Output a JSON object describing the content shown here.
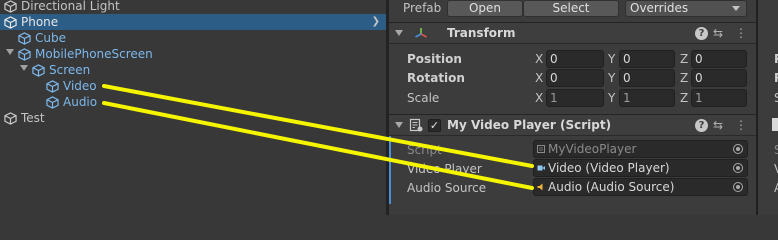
{
  "hierarchy": {
    "items": [
      {
        "label": "Directional Light"
      },
      {
        "label": "Phone"
      },
      {
        "label": "Cube"
      },
      {
        "label": "MobilePhoneScreen"
      },
      {
        "label": "Screen"
      },
      {
        "label": "Video"
      },
      {
        "label": "Audio"
      },
      {
        "label": "Test"
      }
    ]
  },
  "inspector": {
    "prefab": {
      "label": "Prefab",
      "open": "Open",
      "select": "Select",
      "overrides": "Overrides"
    },
    "transform": {
      "title": "Transform",
      "rows": [
        {
          "label": "Position",
          "x": "0",
          "y": "0",
          "z": "0"
        },
        {
          "label": "Rotation",
          "x": "0",
          "y": "0",
          "z": "0"
        },
        {
          "label": "Scale",
          "x": "1",
          "y": "1",
          "z": "1"
        }
      ],
      "axes": {
        "x": "X",
        "y": "Y",
        "z": "Z"
      }
    },
    "script_component": {
      "title": "My Video Player (Script)",
      "fields": [
        {
          "label": "Script",
          "value": "MyVideoPlayer"
        },
        {
          "label": "Video Player",
          "value": "Video (Video Player)"
        },
        {
          "label": "Audio Source",
          "value": "Audio (Audio Source)"
        }
      ]
    }
  },
  "colors": {
    "annotation": "#f5f500",
    "selection": "#2c5d87",
    "prefab_text": "#7cb8ec"
  }
}
